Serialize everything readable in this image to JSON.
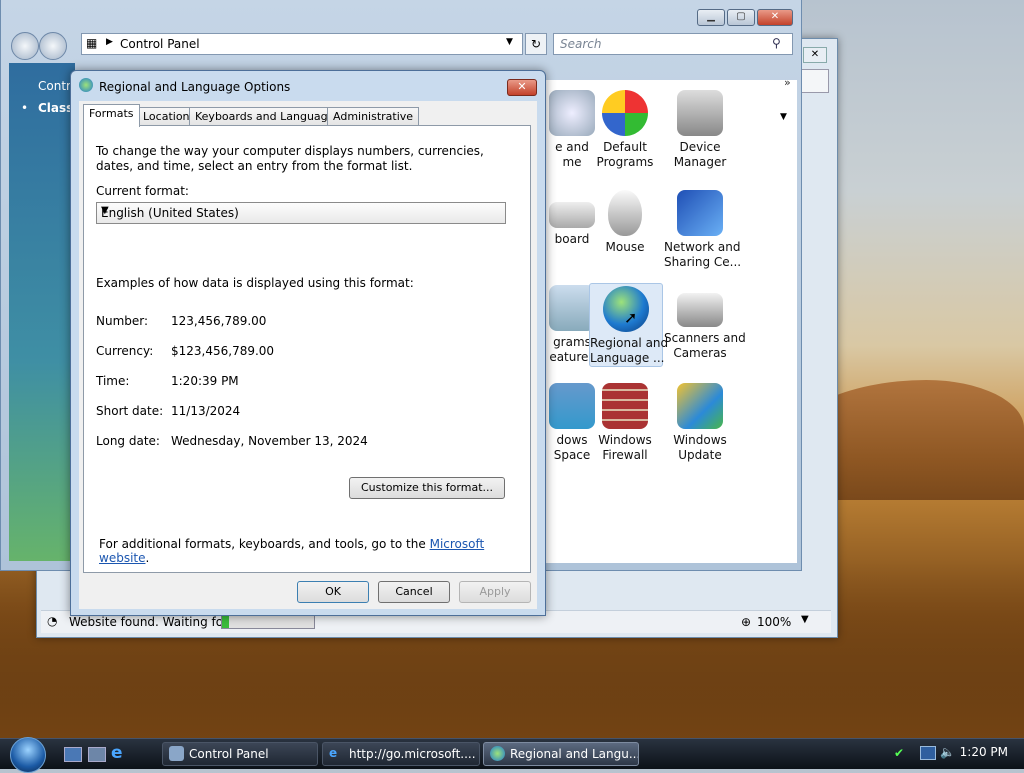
{
  "control_panel": {
    "address": "Control Panel",
    "search_placeholder": "Search",
    "left_items": [
      "Contro",
      "Classic"
    ],
    "icons": [
      {
        "label": "e and\nme"
      },
      {
        "label": "Default\nPrograms"
      },
      {
        "label": "Device\nManager"
      },
      {
        "label": "board"
      },
      {
        "label": "Mouse"
      },
      {
        "label": "Network and\nSharing Ce..."
      },
      {
        "label": "grams\neatures"
      },
      {
        "label": "Regional and\nLanguage ..."
      },
      {
        "label": "Scanners and\nCameras"
      },
      {
        "label": "dows\nSpace"
      },
      {
        "label": "Windows\nFirewall"
      },
      {
        "label": "Windows\nUpdate"
      }
    ]
  },
  "ie": {
    "status_text": "Website found. Waiting for r",
    "zoom": "100%",
    "progress_fraction": 0.08
  },
  "dialog": {
    "title": "Regional and Language Options",
    "close": "✕",
    "tabs": [
      "Formats",
      "Location",
      "Keyboards and Languages",
      "Administrative"
    ],
    "intro": "To change the way your computer displays numbers, currencies, dates, and time, select an entry from the format list.",
    "current_format_label": "Current format:",
    "current_format_value": "English (United States)",
    "examples_heading": "Examples of how data is displayed using this format:",
    "examples": [
      {
        "label": "Number:",
        "value": "123,456,789.00"
      },
      {
        "label": "Currency:",
        "value": "$123,456,789.00"
      },
      {
        "label": "Time:",
        "value": "1:20:39 PM"
      },
      {
        "label": "Short date:",
        "value": "11/13/2024"
      },
      {
        "label": "Long date:",
        "value": "Wednesday, November 13, 2024"
      }
    ],
    "customize_button": "Customize this format...",
    "footer_text": "For additional formats, keyboards, and tools, go to the",
    "footer_link": "Microsoft website",
    "footer_end": ".",
    "ok": "OK",
    "cancel": "Cancel",
    "apply": "Apply"
  },
  "taskbar": {
    "items": [
      "Control Panel",
      "http://go.microsoft....",
      "Regional and Langu..."
    ],
    "clock": "1:20 PM"
  }
}
